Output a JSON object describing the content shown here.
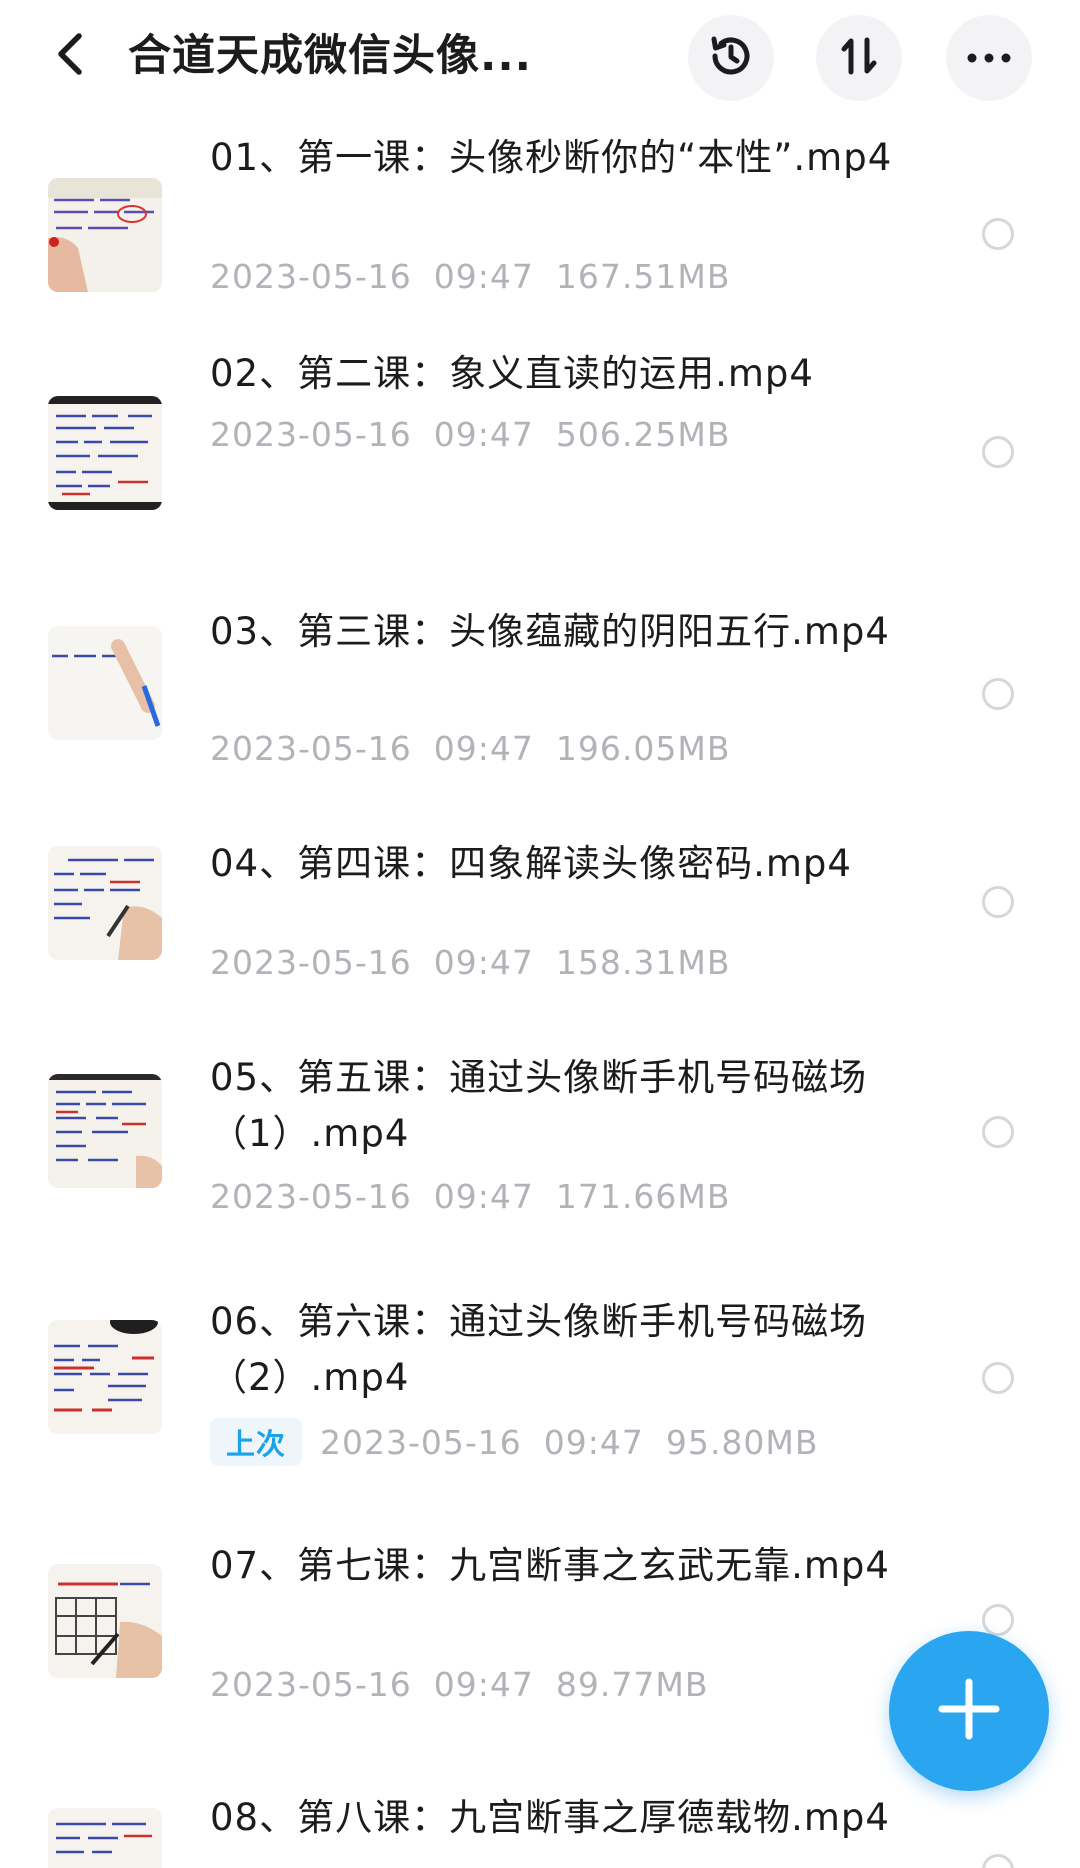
{
  "header": {
    "title": "合道天成微信头像...",
    "back_icon": "chevron-left-icon",
    "history_icon": "history-clock-icon",
    "sort_icon": "sort-arrows-icon",
    "more_icon": "more-dots-icon"
  },
  "files": [
    {
      "name": "01、第一课：头像秒断你的“本性”.mp4",
      "date": "2023-05-16",
      "time": "09:47",
      "size": "167.51MB",
      "badge": ""
    },
    {
      "name": "02、第二课：象义直读的运用.mp4",
      "date": "2023-05-16",
      "time": "09:47",
      "size": "506.25MB",
      "badge": ""
    },
    {
      "name": "03、第三课：头像蕴藏的阴阳五行.mp4",
      "date": "2023-05-16",
      "time": "09:47",
      "size": "196.05MB",
      "badge": ""
    },
    {
      "name": "04、第四课：四象解读头像密码.mp4",
      "date": "2023-05-16",
      "time": "09:47",
      "size": "158.31MB",
      "badge": ""
    },
    {
      "name": "05、第五课：通过头像断手机号码磁场（1）.mp4",
      "date": "2023-05-16",
      "time": "09:47",
      "size": "171.66MB",
      "badge": ""
    },
    {
      "name": "06、第六课：通过头像断手机号码磁场（2）.mp4",
      "date": "2023-05-16",
      "time": "09:47",
      "size": "95.80MB",
      "badge": "上次"
    },
    {
      "name": "07、第七课：九宫断事之玄武无靠.mp4",
      "date": "2023-05-16",
      "time": "09:47",
      "size": "89.77MB",
      "badge": ""
    },
    {
      "name": "08、第八课：九宫断事之厚德载物.mp4",
      "date": "",
      "time": "",
      "size": "",
      "badge": ""
    }
  ],
  "fab": {
    "icon": "plus-icon"
  },
  "colors": {
    "accent": "#2aa6f0",
    "badge_text": "#1aa2ea",
    "meta_text": "#b1b3b8"
  }
}
